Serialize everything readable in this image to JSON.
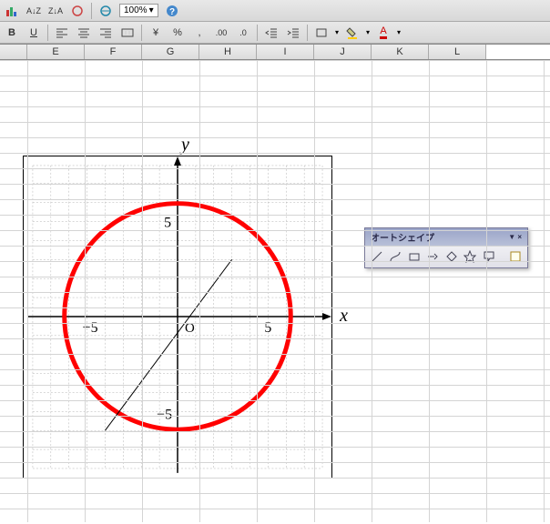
{
  "toolbars": {
    "row1": {
      "sort_az": "A↓Z",
      "sort_za": "Z↓A",
      "zoom": "100%"
    },
    "row2": {
      "bold": "B",
      "underline": "U",
      "currency": "¥",
      "percent": "%",
      "font_color": "A"
    }
  },
  "columns": [
    "E",
    "F",
    "G",
    "H",
    "I",
    "J",
    "K",
    "L"
  ],
  "autoshape": {
    "title": "オートシェイプ"
  },
  "chart_data": {
    "type": "scatter",
    "title": "",
    "xlabel": "x",
    "ylabel": "y",
    "origin_label": "O",
    "xlim": [
      -8,
      8
    ],
    "ylim": [
      -8,
      8
    ],
    "xticks": [
      -5,
      5
    ],
    "yticks": [
      -5,
      5
    ],
    "grid": true,
    "series": [
      {
        "name": "circle",
        "kind": "circle",
        "center": [
          0,
          0
        ],
        "radius": 6,
        "color": "#ff0000"
      },
      {
        "name": "line",
        "kind": "segment",
        "points": [
          [
            -4,
            -6
          ],
          [
            3,
            3
          ]
        ],
        "color": "#000000"
      }
    ]
  }
}
